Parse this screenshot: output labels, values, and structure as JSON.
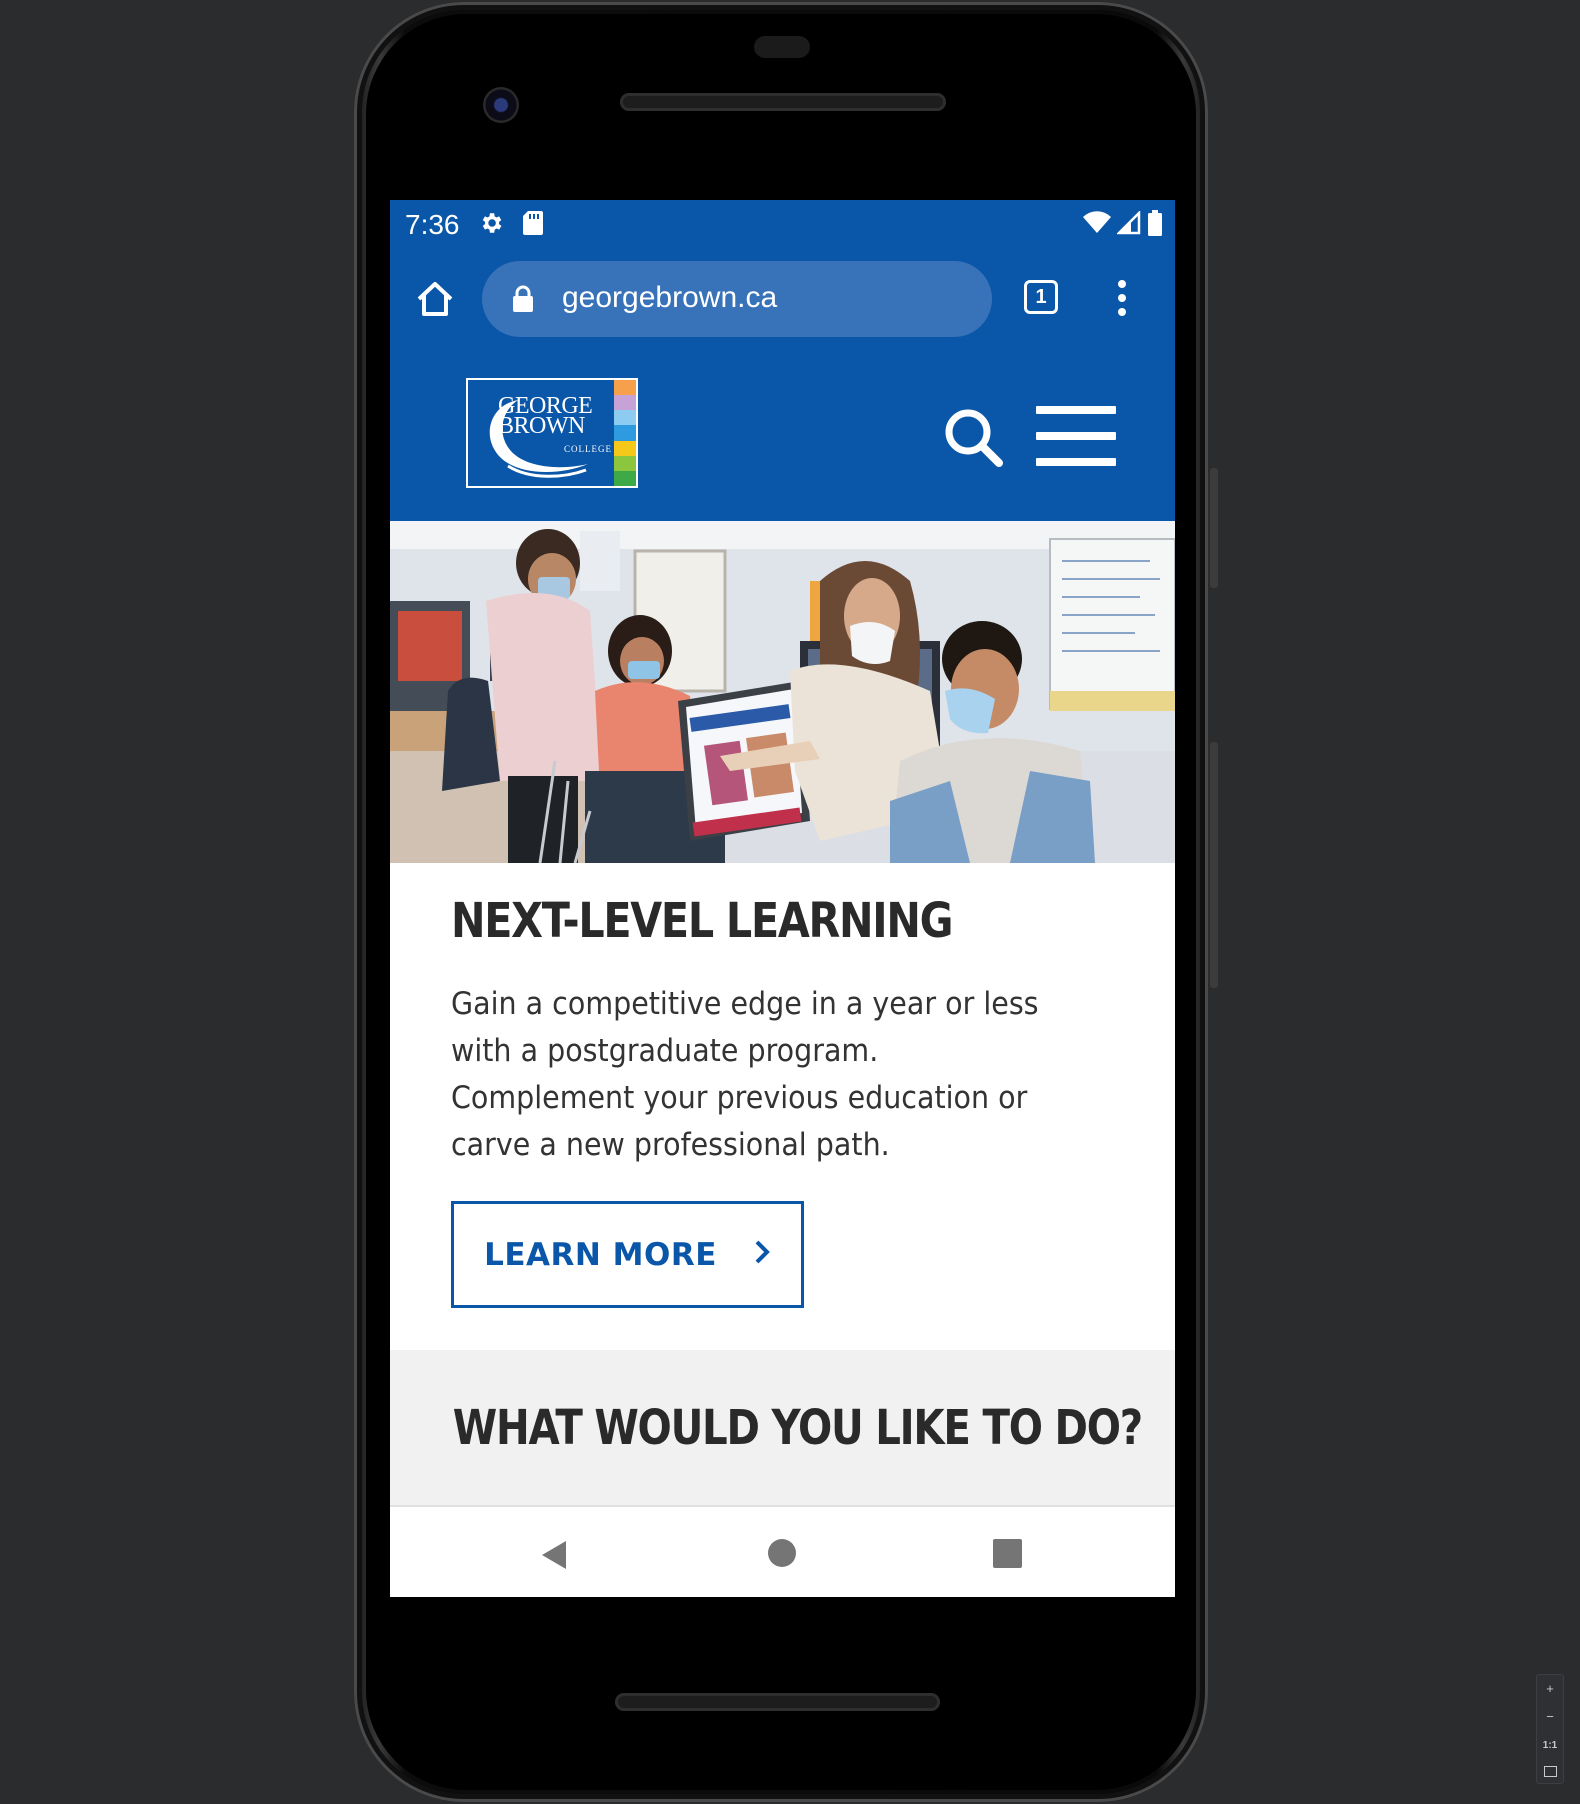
{
  "status_bar": {
    "time": "7:36"
  },
  "browser": {
    "url": "georgebrown.ca",
    "tab_count": "1"
  },
  "site": {
    "logo_line1": "GEORGE",
    "logo_line2": "BROWN",
    "logo_line3": "COLLEGE",
    "logo_colors": [
      "#f6a04b",
      "#c7a2d6",
      "#8ecbf0",
      "#2e9be0",
      "#f6c81a",
      "#8cc63f",
      "#3daa47"
    ]
  },
  "promo": {
    "headline": "NEXT-LEVEL LEARNING",
    "body": "Gain a competitive edge in a year or less with a postgraduate program. Complement your previous education or carve a new professional path.",
    "button_label": "LEARN MORE"
  },
  "section": {
    "title": "WHAT WOULD YOU LIKE TO DO?"
  },
  "emulator": {
    "zoom_in": "+",
    "zoom_out": "−",
    "actual_size": "1:1"
  },
  "colors": {
    "brand_blue": "#0a56a8",
    "text_dark": "#2a2a2a",
    "section_bg": "#f1f1f1"
  }
}
